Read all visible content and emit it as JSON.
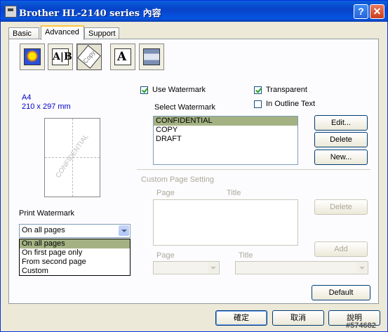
{
  "window": {
    "title": "Brother HL-2140 series 內容",
    "help_glyph": "?",
    "close_glyph": "✕"
  },
  "tabs": [
    {
      "label": "Basic"
    },
    {
      "label": "Advanced"
    },
    {
      "label": "Support"
    }
  ],
  "toolbar_icons": [
    "color-icon",
    "duplex-icon",
    "watermark-icon",
    "font-icon",
    "device-options-icon"
  ],
  "toolbar_glyphs": {
    "duplex": "A|B",
    "watermark": "Copy",
    "font": "A"
  },
  "preview": {
    "paper_size": "A4",
    "paper_dims": "210 x 297 mm",
    "watermark_text": "CONFIDENTIAL"
  },
  "print_watermark": {
    "label": "Print Watermark",
    "selected": "On all pages",
    "options": [
      "On all pages",
      "On first page only",
      "From second page",
      "Custom"
    ]
  },
  "watermark": {
    "use_label": "Use Watermark",
    "use_checked": true,
    "transparent_label": "Transparent",
    "transparent_checked": true,
    "outline_label": "In Outline Text",
    "outline_checked": false,
    "select_label": "Select Watermark",
    "items": [
      "CONFIDENTIAL",
      "COPY",
      "DRAFT"
    ],
    "selected_index": 0,
    "edit_label": "Edit...",
    "delete_label": "Delete",
    "new_label": "New..."
  },
  "custom_page": {
    "label": "Custom Page Setting",
    "col_page": "Page",
    "col_title": "Title",
    "delete_label": "Delete",
    "add_label": "Add",
    "page_label": "Page",
    "title_label": "Title"
  },
  "footer": {
    "default_label": "Default",
    "ok_label": "確定",
    "cancel_label": "取消",
    "help_label": "說明"
  },
  "corner_id": "#574682"
}
